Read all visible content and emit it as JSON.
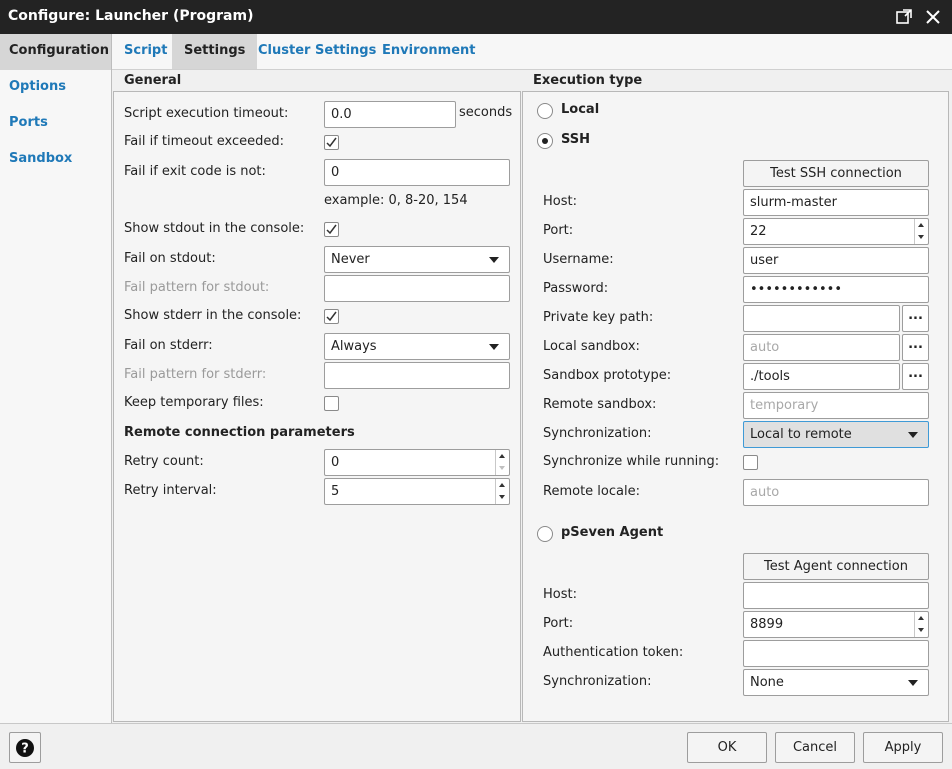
{
  "window": {
    "title": "Configure: Launcher (Program)"
  },
  "sidebar": {
    "items": [
      {
        "label": "Configuration",
        "active": true
      },
      {
        "label": "Options"
      },
      {
        "label": "Ports"
      },
      {
        "label": "Sandbox"
      }
    ]
  },
  "tabs": [
    {
      "label": "Script"
    },
    {
      "label": "Settings",
      "active": true
    },
    {
      "label": "Cluster Settings"
    },
    {
      "label": "Environment"
    }
  ],
  "general": {
    "title": "General",
    "timeout_label": "Script execution timeout:",
    "timeout_value": "0.0",
    "timeout_unit": "seconds",
    "fail_timeout_label": "Fail if timeout exceeded:",
    "fail_timeout_checked": true,
    "fail_exit_label": "Fail if exit code is not:",
    "fail_exit_value": "0",
    "exit_hint": "example: 0, 8-20, 154",
    "show_stdout_label": "Show stdout in the console:",
    "show_stdout_checked": true,
    "fail_stdout_label": "Fail on stdout:",
    "fail_stdout_value": "Never",
    "pattern_stdout_label": "Fail pattern for stdout:",
    "pattern_stdout_value": "",
    "show_stderr_label": "Show stderr in the console:",
    "show_stderr_checked": true,
    "fail_stderr_label": "Fail on stderr:",
    "fail_stderr_value": "Always",
    "pattern_stderr_label": "Fail pattern for stderr:",
    "pattern_stderr_value": "",
    "keep_temp_label": "Keep temporary files:",
    "keep_temp_checked": false,
    "remote_title": "Remote connection parameters",
    "retry_count_label": "Retry count:",
    "retry_count_value": "0",
    "retry_interval_label": "Retry interval:",
    "retry_interval_value": "5"
  },
  "exec": {
    "title": "Execution type",
    "local_label": "Local",
    "ssh_label": "SSH",
    "selected": "SSH",
    "ssh": {
      "test_button": "Test SSH connection",
      "host_label": "Host:",
      "host_value": "slurm-master",
      "port_label": "Port:",
      "port_value": "22",
      "username_label": "Username:",
      "username_value": "user",
      "password_label": "Password:",
      "password_value": "••••••••••••",
      "private_key_label": "Private key path:",
      "private_key_value": "",
      "local_sandbox_label": "Local sandbox:",
      "local_sandbox_placeholder": "auto",
      "sandbox_proto_label": "Sandbox prototype:",
      "sandbox_proto_value": "./tools",
      "remote_sandbox_label": "Remote sandbox:",
      "remote_sandbox_placeholder": "temporary",
      "sync_label": "Synchronization:",
      "sync_value": "Local to remote",
      "sync_running_label": "Synchronize while running:",
      "sync_running_checked": false,
      "remote_locale_label": "Remote locale:",
      "remote_locale_placeholder": "auto",
      "ellipsis": "..."
    },
    "agent": {
      "label": "pSeven Agent",
      "test_button": "Test Agent connection",
      "host_label": "Host:",
      "host_value": "",
      "port_label": "Port:",
      "port_value": "8899",
      "token_label": "Authentication token:",
      "token_value": "",
      "sync_label": "Synchronization:",
      "sync_value": "None"
    }
  },
  "footer": {
    "ok": "OK",
    "cancel": "Cancel",
    "apply": "Apply",
    "help_icon": "?"
  },
  "colors": {
    "titlebar": "#232323",
    "link": "#1f79b8",
    "active_tab": "#d6d6d6",
    "focus": "#3f9ad6"
  },
  "icons": {
    "restore": "restore-window-icon",
    "close": "close-icon",
    "help": "help-icon",
    "check": "checkmark-icon"
  }
}
